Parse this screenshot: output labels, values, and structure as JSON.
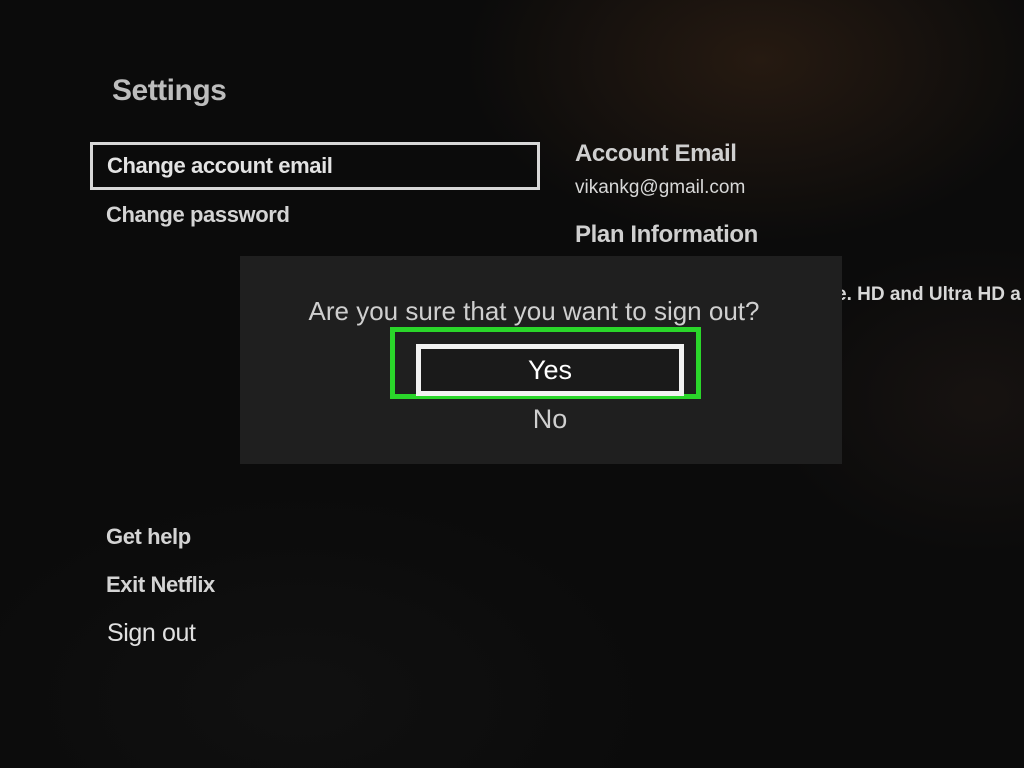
{
  "settings": {
    "title": "Settings",
    "menu": {
      "change_email": "Change account email",
      "change_password": "Change password",
      "get_help": "Get help",
      "exit_netflix": "Exit Netflix",
      "sign_out": "Sign out"
    }
  },
  "account_info": {
    "email_heading": "Account Email",
    "email_value": "vikankg@gmail.com",
    "plan_heading": "Plan Information",
    "plan_detail": "e. HD and Ultra HD a"
  },
  "dialog": {
    "question": "Are you sure that you want to sign out?",
    "yes_label": "Yes",
    "no_label": "No"
  },
  "colors": {
    "highlight": "#2ad62a",
    "focus_border": "#f2f2f2",
    "dialog_bg": "#1f1f1f"
  }
}
